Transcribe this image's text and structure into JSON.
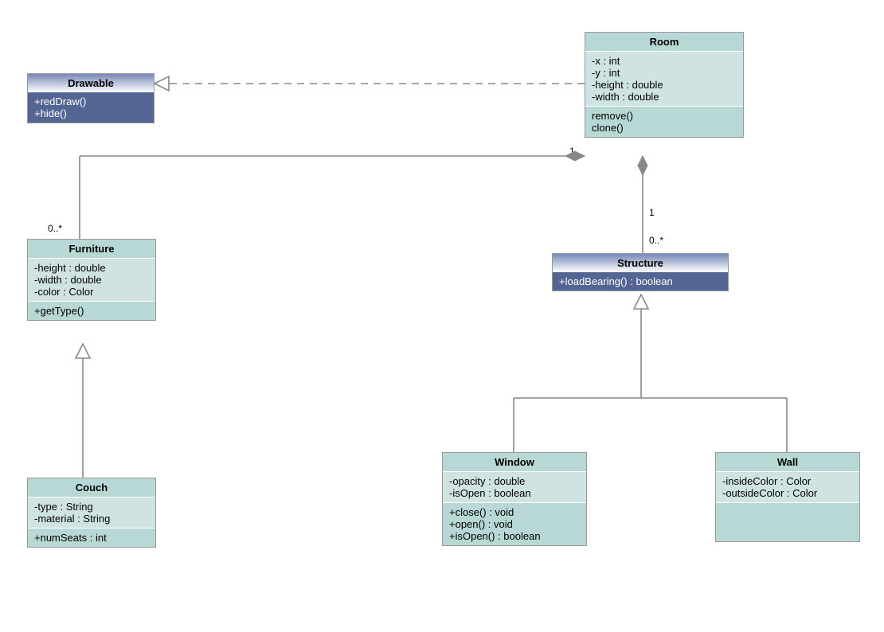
{
  "classes": {
    "drawable": {
      "name": "Drawable",
      "methods": [
        "+redDraw()",
        "+hide()"
      ]
    },
    "room": {
      "name": "Room",
      "attrs": [
        "-x : int",
        "-y : int",
        "-height : double",
        "-width : double"
      ],
      "methods": [
        "remove()",
        "clone()"
      ]
    },
    "furniture": {
      "name": "Furniture",
      "attrs": [
        "-height : double",
        "-width : double",
        "-color : Color"
      ],
      "methods": [
        "+getType()"
      ]
    },
    "structure": {
      "name": "Structure",
      "methods": [
        "+loadBearing() : boolean"
      ]
    },
    "couch": {
      "name": "Couch",
      "attrs": [
        "-type : String",
        "-material : String"
      ],
      "methods": [
        "+numSeats : int"
      ]
    },
    "window": {
      "name": "Window",
      "attrs": [
        "-opacity : double",
        "-isOpen : boolean"
      ],
      "methods": [
        "+close() : void",
        "+open() : void",
        "+isOpen() : boolean"
      ]
    },
    "wall": {
      "name": "Wall",
      "attrs": [
        "-insideColor : Color",
        "-outsideColor : Color"
      ]
    }
  },
  "labels": {
    "m1": "1",
    "m0star": "0..*",
    "m1b": "1",
    "m0starb": "0..*"
  }
}
